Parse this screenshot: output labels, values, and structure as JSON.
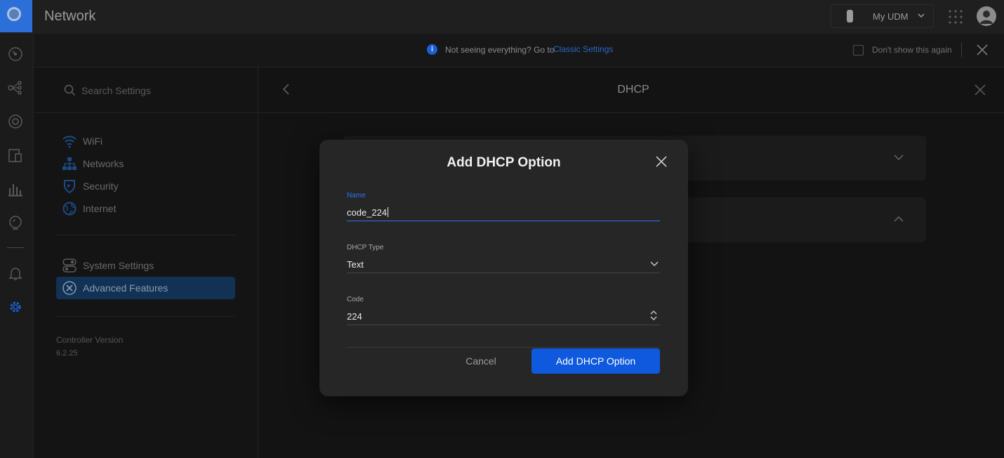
{
  "app": {
    "title": "Network"
  },
  "header": {
    "device_name": "My UDM"
  },
  "banner": {
    "message": "Not seeing everything? Go to",
    "link_text": "Classic Settings",
    "checkbox_label": "Don't show this again",
    "info_glyph": "i"
  },
  "left_nav": {
    "items": [
      {
        "icon": "dashboard-icon"
      },
      {
        "icon": "topology-icon"
      },
      {
        "icon": "devices-icon"
      },
      {
        "icon": "clients-icon"
      },
      {
        "icon": "statistics-icon"
      },
      {
        "icon": "insights-icon"
      },
      {
        "icon": "notifications-icon"
      },
      {
        "icon": "settings-icon"
      }
    ]
  },
  "settings": {
    "search_placeholder": "Search Settings",
    "menu": [
      {
        "label": "WiFi",
        "icon": "wifi-icon"
      },
      {
        "label": "Networks",
        "icon": "networks-icon"
      },
      {
        "label": "Security",
        "icon": "security-shield-icon"
      },
      {
        "label": "Internet",
        "icon": "globe-icon"
      }
    ],
    "menu2": [
      {
        "label": "System Settings",
        "icon": "toggles-icon"
      },
      {
        "label": "Advanced Features",
        "icon": "tools-icon"
      }
    ],
    "controller_version_label": "Controller Version",
    "controller_version": "6.2.25"
  },
  "content": {
    "title": "DHCP"
  },
  "modal": {
    "title": "Add DHCP Option",
    "fields": {
      "name": {
        "label": "Name",
        "value": "code_224"
      },
      "dhcp_type": {
        "label": "DHCP Type",
        "value": "Text"
      },
      "code": {
        "label": "Code",
        "value": "224"
      }
    },
    "cancel_label": "Cancel",
    "submit_label": "Add DHCP Option"
  },
  "colors": {
    "accent": "#0e59dd",
    "focus": "#2f74f0",
    "link": "#2c66c9",
    "active_menu": "#113255"
  }
}
